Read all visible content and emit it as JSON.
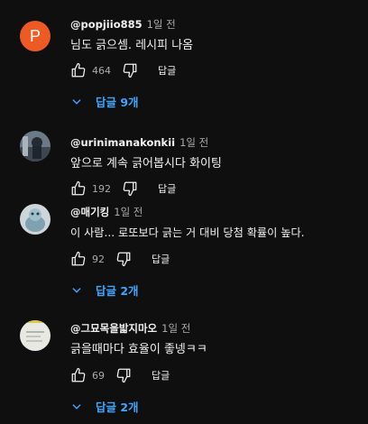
{
  "comments": [
    {
      "avatar_letter": "P",
      "author": "@popjiio885",
      "time": "1일 전",
      "text": "님도 긁으셈. 레시피 나옴",
      "likes": "464",
      "reply_label": "답글",
      "replies_label": "답글 9개"
    },
    {
      "author": "@urinimanakonkii",
      "time": "1일 전",
      "text": "앞으로 계속 긁어봅시다 화이팅",
      "likes": "192",
      "reply_label": "답글"
    },
    {
      "author": "@매기킹",
      "time": "1일 전",
      "text": "이 사람... 로또보다 긁는 거 대비 당첨 확률이 높다.",
      "likes": "92",
      "reply_label": "답글",
      "replies_label": "답글 2개"
    },
    {
      "author": "@그묘목을밟지마오",
      "time": "1일 전",
      "text": "긁을때마다 효율이 좋넹ㅋㅋ",
      "likes": "69",
      "reply_label": "답글",
      "replies_label": "답글 2개"
    }
  ]
}
